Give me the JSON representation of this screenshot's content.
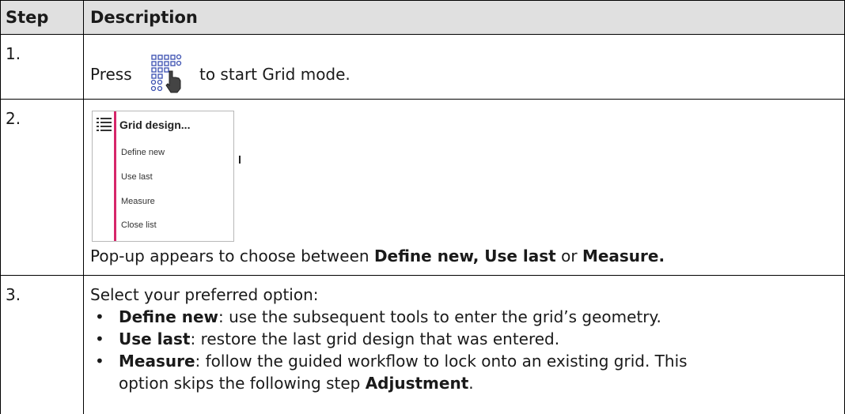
{
  "table": {
    "headers": {
      "step": "Step",
      "description": "Description"
    },
    "rows": [
      {
        "step": "1.",
        "press": "Press",
        "after_icon": "to start Grid mode.",
        "icon": "grid-mode-icon"
      },
      {
        "step": "2.",
        "popup": {
          "title": "Grid design...",
          "items": [
            "Define new",
            "Use last",
            "Measure",
            "Close list"
          ]
        },
        "text_pre": "Pop-up appears to choose between ",
        "text_b1": "Define new, Use last",
        "text_mid": " or ",
        "text_b2": "Measure."
      },
      {
        "step": "3.",
        "intro": "Select your preferred option:",
        "bullets": [
          {
            "bold": "Define new",
            "rest": ": use the subsequent tools to enter the grid’s geometry."
          },
          {
            "bold": "Use last",
            "rest": ": restore the last grid design that was entered."
          },
          {
            "bold": "Measure",
            "rest": ": follow the guided workflow to lock onto an existing grid. This"
          }
        ],
        "cont_pre": "option skips the following step ",
        "cont_bold": "Adjustment",
        "cont_post": "."
      }
    ]
  }
}
